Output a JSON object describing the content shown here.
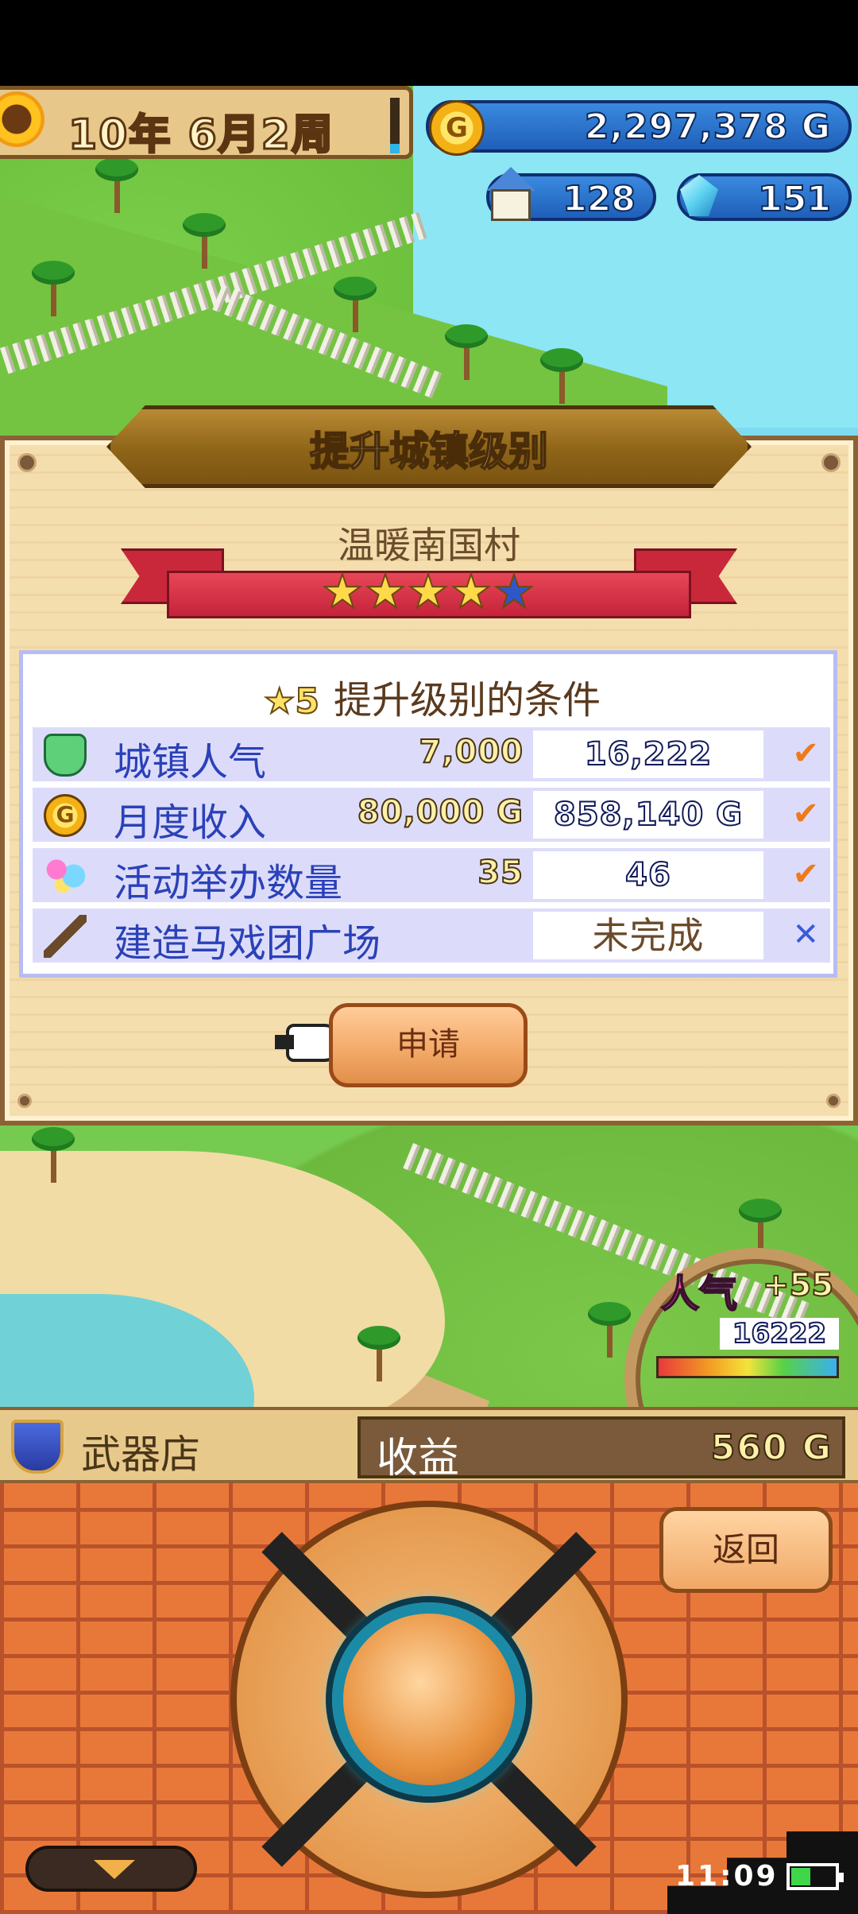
{
  "hud": {
    "date_text": "10年 6月2周",
    "gold": "2,297,378 G",
    "coin_letter": "G",
    "houses": "128",
    "gems": "151"
  },
  "dialog": {
    "title": "提升城镇级别",
    "town_name": "温暖南国村",
    "stars": {
      "filled": 4,
      "total": 5
    },
    "conditions_title": "提升级别的条件",
    "next_level": "5",
    "conditions": [
      {
        "icon": "trophy-icon",
        "label": "城镇人气",
        "required": "7,000",
        "current": "16,222",
        "status": "done"
      },
      {
        "icon": "coin-icon",
        "label": "月度收入",
        "required": "80,000 G",
        "current": "858,140 G",
        "status": "done"
      },
      {
        "icon": "balloon-icon",
        "label": "活动举办数量",
        "required": "35",
        "current": "46",
        "status": "done"
      },
      {
        "icon": "hammer-icon",
        "label": "建造马戏团广场",
        "required": "",
        "current": "未完成",
        "status": "incomplete"
      }
    ],
    "check_mark": "✔",
    "cross_mark": "✕",
    "apply_label": "申请"
  },
  "popularity": {
    "label": "人气",
    "delta": "+55",
    "value": "16222"
  },
  "info_bar": {
    "building": "武器店",
    "earnings_label": "收益",
    "earnings_value": "560 G"
  },
  "controls": {
    "back_label": "返回"
  },
  "status": {
    "time": "11:09"
  },
  "colors": {
    "dialog_bg": "#f5deae",
    "condition_row": "#dcdcfa",
    "label_blue": "#2b41b8",
    "check_orange": "#f07a1a"
  }
}
